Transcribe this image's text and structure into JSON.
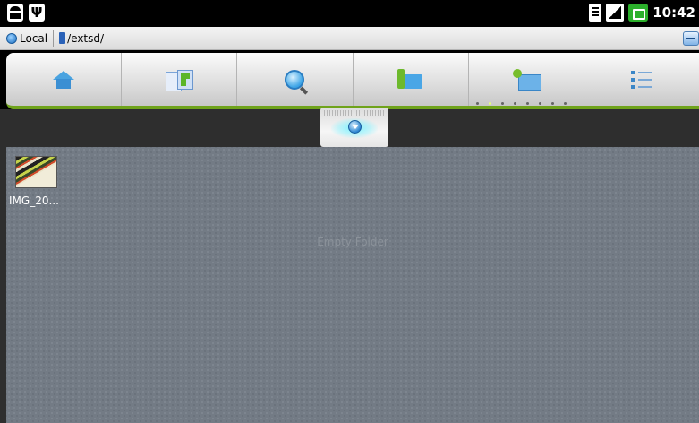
{
  "status_bar": {
    "left_icons": [
      "android-icon",
      "usb-icon"
    ],
    "right_icons": [
      "sd-card-icon",
      "signal-icon",
      "battery-icon"
    ],
    "time": "10:42"
  },
  "path_bar": {
    "location": "Local",
    "path": "/extsd/"
  },
  "toolbar": {
    "buttons": [
      {
        "name": "home-icon"
      },
      {
        "name": "copy-icon"
      },
      {
        "name": "search-icon"
      },
      {
        "name": "up-folder-icon"
      },
      {
        "name": "settings-icon"
      },
      {
        "name": "list-view-icon"
      }
    ]
  },
  "content": {
    "files": [
      {
        "label": "IMG_20..."
      }
    ],
    "empty_message": "Empty Folder"
  },
  "colors": {
    "accent_green": "#6fa31b",
    "content_bg": "#737b85"
  }
}
